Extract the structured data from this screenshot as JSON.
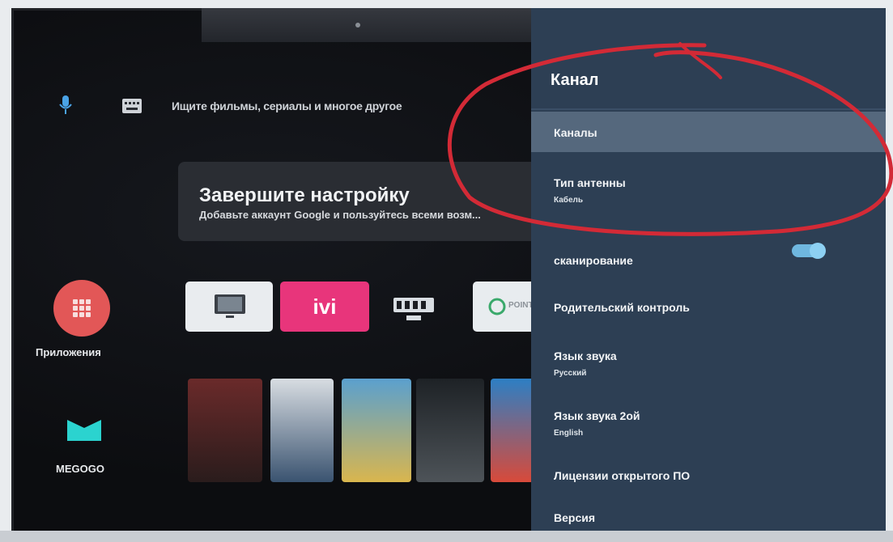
{
  "home": {
    "search_placeholder": "Ищите фильмы, сериалы и многое другое",
    "setup_title": "Завершите настройку",
    "setup_subtitle": "Добавьте аккаунт Google и пользуйтесь всеми возм...",
    "apps_label": "Приложения",
    "megogo_label": "MEGOGO",
    "tiles": {
      "ivi_label": "ivi",
      "point_label": "POINT"
    }
  },
  "panel": {
    "title": "Канал",
    "items": [
      {
        "label": "Каналы",
        "sub": ""
      },
      {
        "label": "Тип антенны",
        "sub": "Кабель"
      },
      {
        "label": "сканирование",
        "sub": ""
      },
      {
        "label": "Родительский контроль",
        "sub": ""
      },
      {
        "label": "Язык звука",
        "sub": "Русский"
      },
      {
        "label": "Язык звука 2ой",
        "sub": "English"
      },
      {
        "label": "Лицензии открытого ПО",
        "sub": ""
      },
      {
        "label": "Версия",
        "sub": ""
      }
    ],
    "toggle_on": true
  },
  "colors": {
    "panel_bg": "#2d3f54",
    "selected_bg": "#55687d",
    "annotation": "#d32a36",
    "apps_accent": "#e25757",
    "ivi_accent": "#e8357b",
    "megogo_accent": "#2bd3cf"
  }
}
